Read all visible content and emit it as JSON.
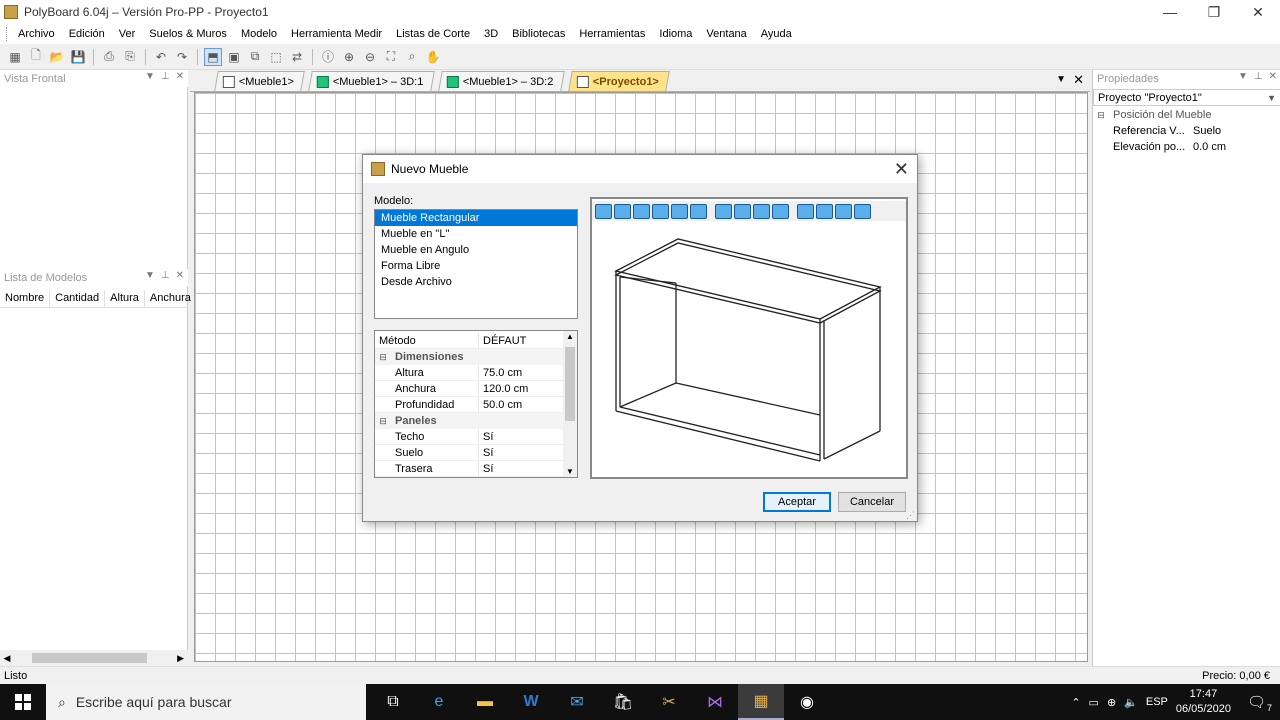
{
  "window": {
    "title": "PolyBoard 6.04j – Versión Pro-PP - Proyecto1"
  },
  "menu": [
    "Archivo",
    "Edición",
    "Ver",
    "Suelos & Muros",
    "Modelo",
    "Herramienta Medir",
    "Listas de Corte",
    "3D",
    "Bibliotecas",
    "Herramientas",
    "Idioma",
    "Ventana",
    "Ayuda"
  ],
  "left_panels": {
    "front_view_title": "Vista Frontal",
    "models_title": "Lista de Modelos",
    "columns": [
      "Nombre",
      "Cantidad",
      "Altura",
      "Anchura"
    ]
  },
  "tabs": [
    "<Mueble1>",
    "<Mueble1> – 3D:1",
    "<Mueble1> – 3D:2",
    "<Proyecto1>"
  ],
  "properties": {
    "title": "Propiedades",
    "combo": "Proyecto \"Proyecto1\"",
    "category": "Posición del Mueble",
    "rows": [
      {
        "k": "Referencia V...",
        "v": "Suelo"
      },
      {
        "k": "Elevación po...",
        "v": "0.0 cm"
      }
    ]
  },
  "dialog": {
    "title": "Nuevo Mueble",
    "model_label": "Modelo:",
    "models": [
      "Mueble Rectangular",
      "Mueble en \"L\"",
      "Mueble en Angulo",
      "Forma Libre",
      "Desde Archivo"
    ],
    "selected_model": "Mueble Rectangular",
    "grid": {
      "method_key": "Método",
      "method_value": "DÉFAUT",
      "dimensions_cat": "Dimensiones",
      "dims": [
        {
          "k": "Altura",
          "v": "75.0 cm"
        },
        {
          "k": "Anchura",
          "v": "120.0 cm"
        },
        {
          "k": "Profundidad",
          "v": "50.0 cm"
        }
      ],
      "panels_cat": "Paneles",
      "panels": [
        {
          "k": "Techo",
          "v": "Sí"
        },
        {
          "k": "Suelo",
          "v": "Sí"
        },
        {
          "k": "Trasera",
          "v": "Sí"
        }
      ]
    },
    "accept": "Aceptar",
    "cancel": "Cancelar"
  },
  "status": {
    "left": "Listo",
    "right": "Precio: 0,00 €"
  },
  "taskbar": {
    "search_placeholder": "Escribe aquí para buscar",
    "lang": "ESP",
    "time": "17:47",
    "date": "06/05/2020",
    "notifications": "7"
  },
  "colors": {
    "selection": "#0078d7",
    "grid": "#b8c3e8",
    "active_tab": "#ffe38a"
  }
}
